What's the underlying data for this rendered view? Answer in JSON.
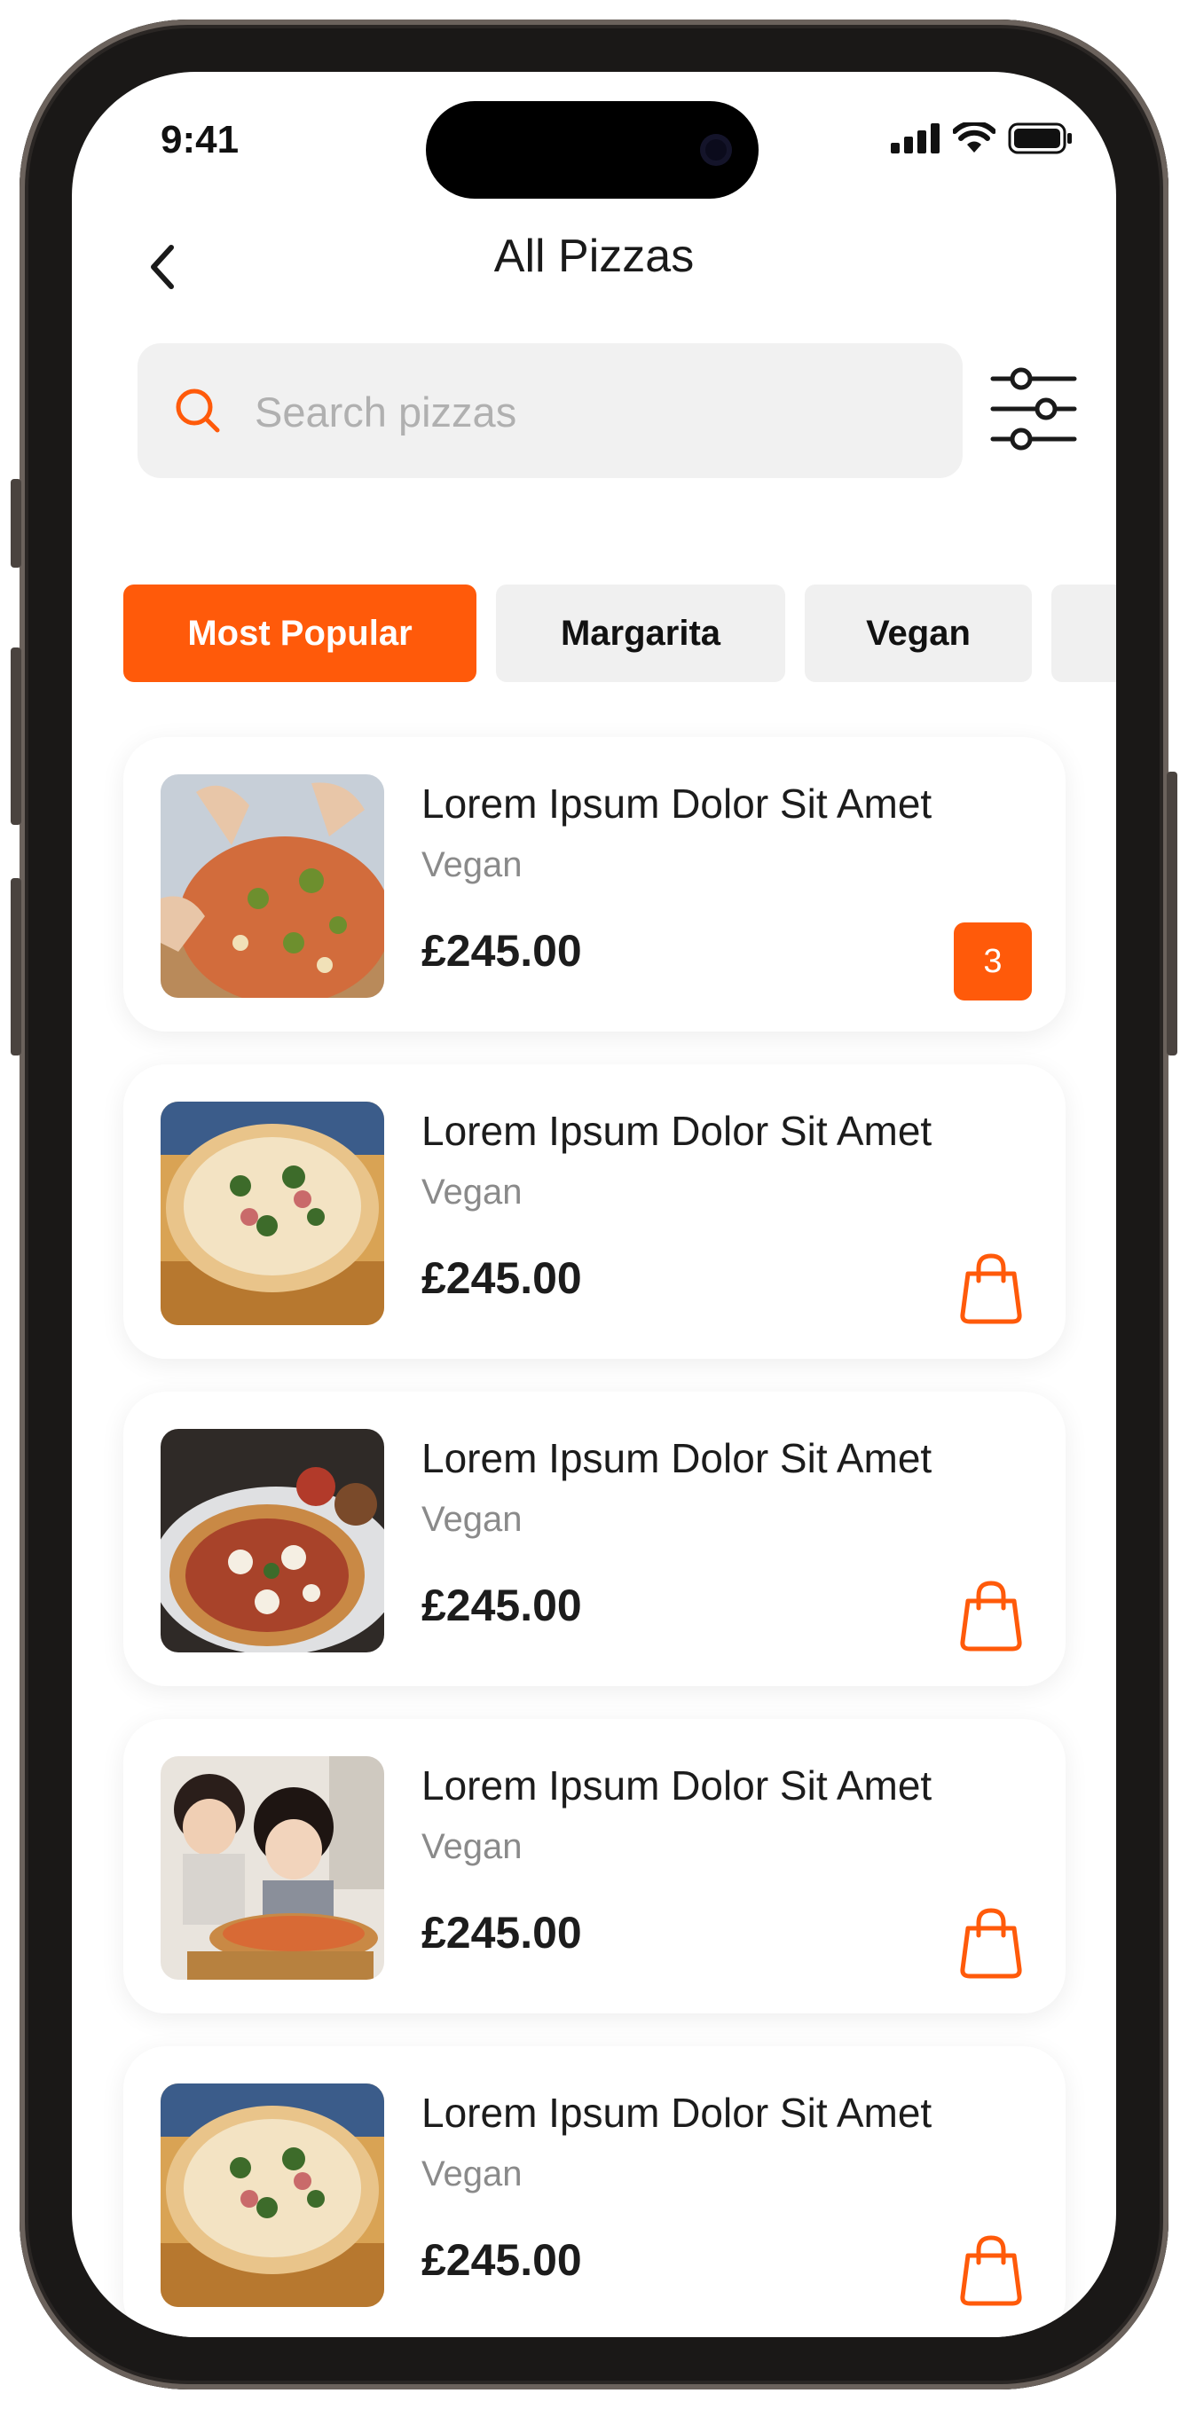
{
  "status_bar": {
    "time": "9:41"
  },
  "header": {
    "title": "All Pizzas"
  },
  "search": {
    "placeholder": "Search pizzas",
    "value": ""
  },
  "categories": [
    {
      "label": "Most Popular",
      "active": true
    },
    {
      "label": "Margarita",
      "active": false
    },
    {
      "label": "Vegan",
      "active": false
    },
    {
      "label": "",
      "active": false
    }
  ],
  "products": [
    {
      "title": "Lorem Ipsum Dolor Sit Amet",
      "subtitle": "Vegan",
      "price": "£245.00",
      "in_cart_qty": "3"
    },
    {
      "title": "Lorem Ipsum Dolor Sit Amet",
      "subtitle": "Vegan",
      "price": "£245.00"
    },
    {
      "title": "Lorem Ipsum Dolor Sit Amet",
      "subtitle": "Vegan",
      "price": "£245.00"
    },
    {
      "title": "Lorem Ipsum Dolor Sit Amet",
      "subtitle": "Vegan",
      "price": "£245.00"
    },
    {
      "title": "Lorem Ipsum Dolor Sit Amet",
      "subtitle": "Vegan",
      "price": "£245.00"
    }
  ],
  "colors": {
    "accent": "#ff5a0a",
    "chip_bg": "#f0f0f0",
    "search_bg": "#f1f1f1"
  },
  "icons": [
    "back-chevron-icon",
    "search-icon",
    "filter-sliders-icon",
    "shopping-bag-icon"
  ]
}
